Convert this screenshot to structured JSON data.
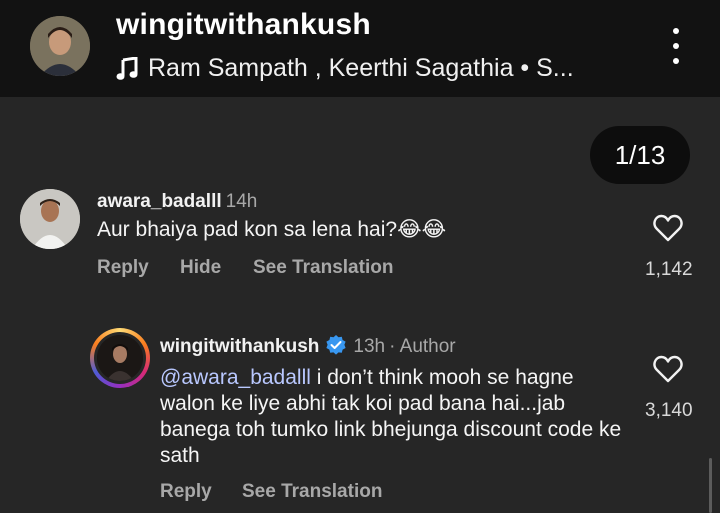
{
  "header": {
    "username": "wingitwithankush",
    "music": "Ram Sampath , Keerthi Sagathia • S..."
  },
  "pager": {
    "label": "1/13"
  },
  "comments": [
    {
      "username": "awara_badalll",
      "time": "14h",
      "text": "Aur bhaiya pad kon sa lena hai?",
      "emoji": "😂😂",
      "actions": {
        "reply": "Reply",
        "hide": "Hide",
        "translate": "See Translation"
      },
      "likes": "1,142"
    },
    {
      "username": "wingitwithankush",
      "time": "13h",
      "author_tag": "· Author",
      "mention": "@awara_badalll",
      "text": " i don’t think mooh se hagne walon ke liye abhi tak koi pad bana hai...jab banega toh tumko link bhejunga discount code ke sath",
      "actions": {
        "reply": "Reply",
        "translate": "See Translation"
      },
      "likes": "3,140"
    }
  ],
  "colors": {
    "background": "#262626",
    "topbar": "#121212",
    "verified": "#3897f0",
    "muted_text": "#a8a8a8"
  },
  "icons": [
    "music-note-icon",
    "more-options-icon",
    "heart-icon",
    "verified-badge-icon"
  ]
}
